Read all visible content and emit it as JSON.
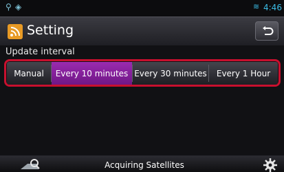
{
  "status": {
    "time": "4:46"
  },
  "header": {
    "title": "Setting"
  },
  "section": {
    "label": "Update interval"
  },
  "options": [
    {
      "label": "Manual",
      "selected": false
    },
    {
      "label": "Every 10 minutes",
      "selected": true
    },
    {
      "label": "Every 30 minutes",
      "selected": false
    },
    {
      "label": "Every 1 Hour",
      "selected": false
    }
  ],
  "footer": {
    "status_text": "Acquiring Satellites"
  },
  "colors": {
    "selected": "#8a23a0",
    "highlight_frame": "#c8102e",
    "accent": "#3bbde6"
  }
}
